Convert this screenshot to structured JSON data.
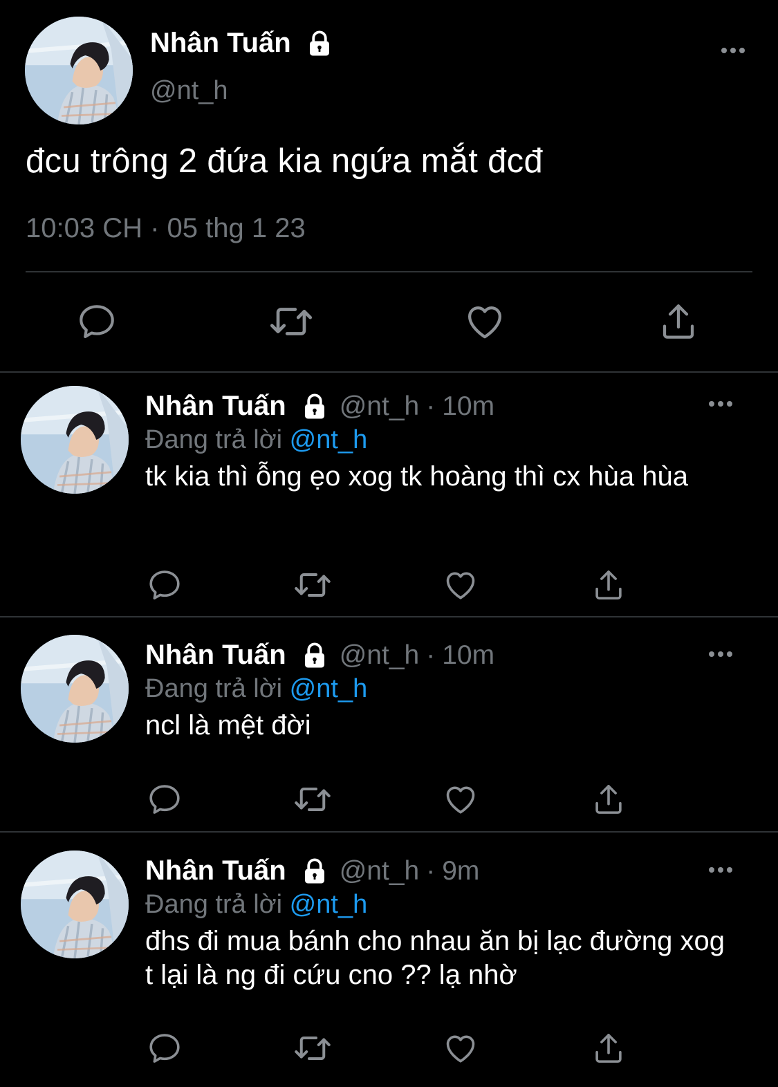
{
  "main_tweet": {
    "display_name": "Nhân Tuấn",
    "handle": "@nt_h",
    "text": "đcu trông 2 đứa kia ngứa mắt đcđ",
    "timestamp": "10:03 CH · 05 thg 1 23"
  },
  "replies": [
    {
      "display_name": "Nhân Tuấn",
      "handle": "@nt_h",
      "dot": "·",
      "time": "10m",
      "replying_label": "Đang trả lời",
      "replying_to": "@nt_h",
      "text": "tk kia thì ỗng ẹo xog tk hoàng thì cx hùa hùa"
    },
    {
      "display_name": "Nhân Tuấn",
      "handle": "@nt_h",
      "dot": "·",
      "time": "10m",
      "replying_label": "Đang trả lời",
      "replying_to": "@nt_h",
      "text": "ncl là mệt đời"
    },
    {
      "display_name": "Nhân Tuấn",
      "handle": "@nt_h",
      "dot": "·",
      "time": "9m",
      "replying_label": "Đang trả lời",
      "replying_to": "@nt_h",
      "text": "đhs đi mua bánh cho nhau ăn bị lạc đường xog t lại là ng đi cứu cno ?? lạ nhờ"
    }
  ],
  "icons": [
    "lock-icon",
    "more-icon",
    "reply-icon",
    "retweet-icon",
    "like-icon",
    "share-icon"
  ],
  "colors": {
    "background": "#000000",
    "text": "#ffffff",
    "secondary_text": "#71767b",
    "mention": "#1d9bf0",
    "divider": "#2f3336"
  }
}
